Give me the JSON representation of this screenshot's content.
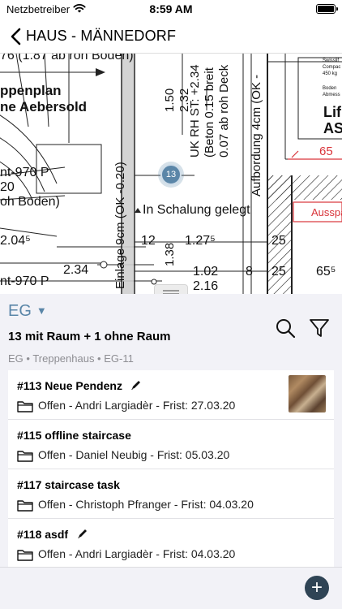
{
  "status": {
    "carrier": "Netzbetreiber",
    "time": "8:59 AM"
  },
  "nav": {
    "title": "HAUS - MÄNNEDORF"
  },
  "plan": {
    "labels": {
      "t1": "76 (1.87 ab roh Boden)",
      "t2": "ppenplan",
      "t3": "ne Aebersold",
      "t4": "nt-970 P",
      "t5": "20",
      "t6": "oh Boden)",
      "t7": "In Schalung gelegt",
      "t8": "2.04⁵",
      "t9": "12",
      "t10": "1.27⁵",
      "t11": "25",
      "t12": "2.34",
      "t13": "1.02",
      "t14": "8",
      "t15": "25",
      "t16": "65⁵",
      "t17": "nt-970 P",
      "t18": "2.16",
      "t19": "65",
      "t20": "Ausspa",
      "t21": "Lif",
      "t22": "AS",
      "v1": "Einlage 9cm (OK -0.20)",
      "v2": "1.50",
      "v3": "2.32",
      "v4": "1.38",
      "v5": "UK RH ST: +2.34",
      "v6": "(Beton 0.15 breit",
      "v7": "0.07 ab roh Deck",
      "v8": "Aufbordung 4cm (OK -",
      "s1": "Swisslif",
      "s2": "Compac",
      "s3": "450 kg",
      "s4": "Boden",
      "s5": "Abmess"
    },
    "marker": "13"
  },
  "panel": {
    "floor": "EG",
    "caret": "▼",
    "count": "13 mit Raum + 1 ohne Raum",
    "breadcrumb": "EG • Treppenhaus • EG-11"
  },
  "tasks": [
    {
      "title": "#113 Neue Pendenz",
      "meta": "Offen - Andri Largiadèr - Frist: 27.03.20",
      "editable": true,
      "thumbnail": true
    },
    {
      "title": "#115 offline staircase",
      "meta": "Offen - Daniel Neubig - Frist: 05.03.20",
      "editable": false,
      "thumbnail": false
    },
    {
      "title": "#117 staircase task",
      "meta": "Offen - Christoph Pfranger - Frist: 04.03.20",
      "editable": false,
      "thumbnail": false
    },
    {
      "title": "#118 asdf",
      "meta": "Offen - Andri Largiadèr - Frist: 04.03.20",
      "editable": true,
      "thumbnail": false
    }
  ],
  "icons": {
    "back": "chevron-left-icon",
    "search": "search-icon",
    "filter": "filter-icon",
    "pencil": "pencil-icon",
    "folder": "folder-icon",
    "add": "plus-icon"
  },
  "add_label": "+",
  "colors": {
    "accent": "#5a86a8",
    "add_button": "#2f4455",
    "plan_red": "#d9343a"
  }
}
